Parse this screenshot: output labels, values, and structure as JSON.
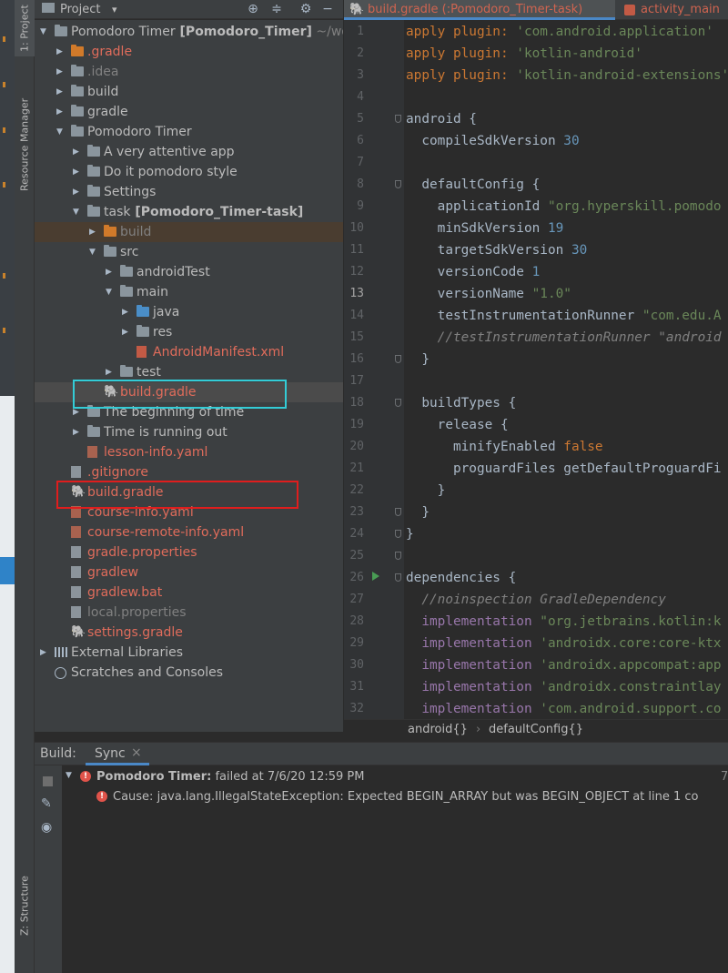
{
  "leftbar": {
    "project_tab": "1: Project",
    "resource_tab": "Resource Manager",
    "structure_tab": "Z: Structure"
  },
  "project_panel": {
    "title": "Project",
    "dropdown_glyph": "▾",
    "header_icons": [
      "crosshair-icon",
      "collapse-icon",
      "gear-icon",
      "hide-icon"
    ]
  },
  "tree": [
    {
      "label": "Pomodoro Timer",
      "suffix": "[Pomodoro_Timer]",
      "path": "~/wor",
      "icon": "folder"
    },
    {
      "label": ".gradle",
      "icon": "folder-orange",
      "style": "red"
    },
    {
      "label": ".idea",
      "icon": "folder",
      "style": "dim"
    },
    {
      "label": "build",
      "icon": "folder"
    },
    {
      "label": "gradle",
      "icon": "folder"
    },
    {
      "label": "Pomodoro Timer",
      "icon": "folder"
    },
    {
      "label": "A very attentive app",
      "icon": "folder"
    },
    {
      "label": "Do it pomodoro style",
      "icon": "folder"
    },
    {
      "label": "Settings",
      "icon": "folder"
    },
    {
      "label": "task",
      "suffix": "[Pomodoro_Timer-task]",
      "icon": "folder"
    },
    {
      "label": "build",
      "icon": "folder-orange",
      "style": "dim"
    },
    {
      "label": "src",
      "icon": "folder"
    },
    {
      "label": "androidTest",
      "icon": "folder"
    },
    {
      "label": "main",
      "icon": "folder"
    },
    {
      "label": "java",
      "icon": "folder-blue"
    },
    {
      "label": "res",
      "icon": "folder"
    },
    {
      "label": "AndroidManifest.xml",
      "icon": "file-red",
      "style": "red"
    },
    {
      "label": "test",
      "icon": "folder"
    },
    {
      "label": "build.gradle",
      "icon": "gradle",
      "style": "red"
    },
    {
      "label": "The beginning of time",
      "icon": "folder"
    },
    {
      "label": "Time is running out",
      "icon": "folder"
    },
    {
      "label": "lesson-info.yaml",
      "icon": "file-yaml",
      "style": "red"
    },
    {
      "label": ".gitignore",
      "icon": "file",
      "style": "red"
    },
    {
      "label": "build.gradle",
      "icon": "gradle",
      "style": "red"
    },
    {
      "label": "course-info.yaml",
      "icon": "file-yaml",
      "style": "red"
    },
    {
      "label": "course-remote-info.yaml",
      "icon": "file-yaml",
      "style": "red"
    },
    {
      "label": "gradle.properties",
      "icon": "file",
      "style": "red"
    },
    {
      "label": "gradlew",
      "icon": "file",
      "style": "red"
    },
    {
      "label": "gradlew.bat",
      "icon": "file",
      "style": "red"
    },
    {
      "label": "local.properties",
      "icon": "file",
      "style": "dim"
    },
    {
      "label": "settings.gradle",
      "icon": "gradle",
      "style": "red"
    },
    {
      "label": "External Libraries",
      "icon": "library"
    },
    {
      "label": "Scratches and Consoles",
      "icon": "scratch"
    }
  ],
  "tabs": {
    "active": "build.gradle (:Pomodoro_Timer-task)",
    "second": "activity_main"
  },
  "code_lines": [
    [
      [
        "kw",
        "apply plugin: "
      ],
      [
        "str",
        "'com.android.application'"
      ]
    ],
    [
      [
        "kw",
        "apply plugin: "
      ],
      [
        "str",
        "'kotlin-android'"
      ]
    ],
    [
      [
        "kw",
        "apply plugin: "
      ],
      [
        "str",
        "'kotlin-android-extensions'"
      ]
    ],
    [],
    [
      [
        "fn",
        "android {"
      ]
    ],
    [
      [
        "fn",
        "  compileSdkVersion "
      ],
      [
        "num",
        "30"
      ]
    ],
    [],
    [
      [
        "fn",
        "  defaultConfig {"
      ]
    ],
    [
      [
        "fn",
        "    applicationId "
      ],
      [
        "str",
        "\"org.hyperskill.pomodo"
      ]
    ],
    [
      [
        "fn",
        "    minSdkVersion "
      ],
      [
        "num",
        "19"
      ]
    ],
    [
      [
        "fn",
        "    targetSdkVersion "
      ],
      [
        "num",
        "30"
      ]
    ],
    [
      [
        "fn",
        "    versionCode "
      ],
      [
        "num",
        "1"
      ]
    ],
    [
      [
        "fn",
        "    versionName "
      ],
      [
        "str",
        "\"1.0\""
      ]
    ],
    [
      [
        "fn",
        "    testInstrumentationRunner "
      ],
      [
        "str",
        "\"com.edu.A"
      ]
    ],
    [
      [
        "cmt",
        "    //testInstrumentationRunner \"android"
      ]
    ],
    [
      [
        "fn",
        "  }"
      ]
    ],
    [],
    [
      [
        "fn",
        "  buildTypes {"
      ]
    ],
    [
      [
        "fn",
        "    release {"
      ]
    ],
    [
      [
        "fn",
        "      minifyEnabled "
      ],
      [
        "kw",
        "false"
      ]
    ],
    [
      [
        "fn",
        "      proguardFiles getDefaultProguardFi"
      ]
    ],
    [
      [
        "fn",
        "    }"
      ]
    ],
    [
      [
        "fn",
        "  }"
      ]
    ],
    [
      [
        "fn",
        "}"
      ]
    ],
    [],
    [
      [
        "fn",
        "dependencies {"
      ]
    ],
    [
      [
        "cmt",
        "  //noinspection GradleDependency"
      ]
    ],
    [
      [
        "fn",
        "  "
      ],
      [
        "kwp",
        "implementation "
      ],
      [
        "str",
        "\"org.jetbrains.kotlin:k"
      ]
    ],
    [
      [
        "fn",
        "  "
      ],
      [
        "kwp",
        "implementation "
      ],
      [
        "str",
        "'androidx.core:core-ktx"
      ]
    ],
    [
      [
        "fn",
        "  "
      ],
      [
        "kwp",
        "implementation "
      ],
      [
        "str",
        "'androidx.appcompat:app"
      ]
    ],
    [
      [
        "fn",
        "  "
      ],
      [
        "kwp",
        "implementation "
      ],
      [
        "str",
        "'androidx.constraintlay"
      ]
    ],
    [
      [
        "fn",
        "  "
      ],
      [
        "kwp",
        "implementation "
      ],
      [
        "str",
        "'com.android.support.co"
      ]
    ]
  ],
  "breadcrumb": {
    "first": "android{}",
    "sep": "›",
    "second": "defaultConfig{}"
  },
  "build": {
    "label": "Build:",
    "tab": "Sync",
    "close_glyph": "×",
    "title_bold": "Pomodoro Timer:",
    "title_rest": " failed at 7/6/20 12:59 PM",
    "right_stub": "7",
    "cause": "Cause: java.lang.IllegalStateException: Expected BEGIN_ARRAY but was BEGIN_OBJECT at line 1 co"
  }
}
